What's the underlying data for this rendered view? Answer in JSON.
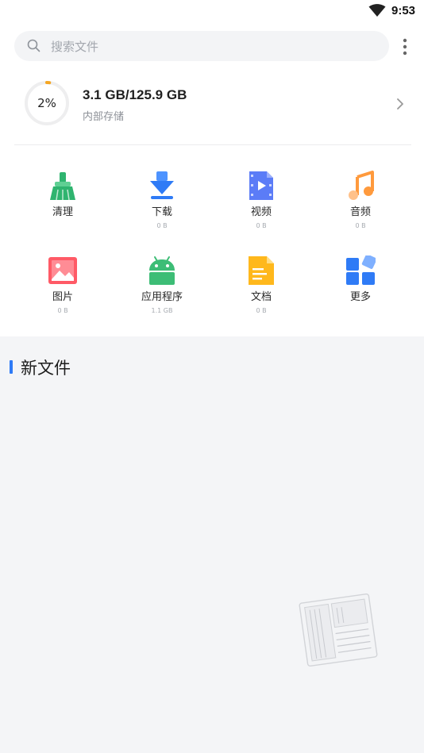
{
  "status_bar": {
    "time": "9:53",
    "icons": [
      "wifi-icon"
    ]
  },
  "search": {
    "placeholder": "搜索文件",
    "icon": "search-icon",
    "menu_icon": "more-vert-icon"
  },
  "storage": {
    "percent_label": "2%",
    "used_fraction": 0.02,
    "size_text": "3.1 GB/125.9 GB",
    "label": "内部存储",
    "accent": "#f5a623"
  },
  "categories": [
    {
      "label": "清理",
      "size": "",
      "icon": "broom-icon",
      "color": "#2fb46f"
    },
    {
      "label": "下载",
      "size": "0 B",
      "icon": "download-icon",
      "color": "#2f7bf6"
    },
    {
      "label": "视频",
      "size": "0 B",
      "icon": "video-file-icon",
      "color": "#5b7cf7"
    },
    {
      "label": "音频",
      "size": "0 B",
      "icon": "music-note-icon",
      "color": "#ff9a3d"
    },
    {
      "label": "图片",
      "size": "0 B",
      "icon": "image-icon",
      "color": "#ff5a66"
    },
    {
      "label": "应用程序",
      "size": "1.1 GB",
      "icon": "android-icon",
      "color": "#3dbd76"
    },
    {
      "label": "文档",
      "size": "0 B",
      "icon": "document-icon",
      "color": "#ffb81c"
    },
    {
      "label": "更多",
      "size": "",
      "icon": "grid-more-icon",
      "color": "#2f7bf6"
    }
  ],
  "new_files": {
    "title": "新文件"
  }
}
